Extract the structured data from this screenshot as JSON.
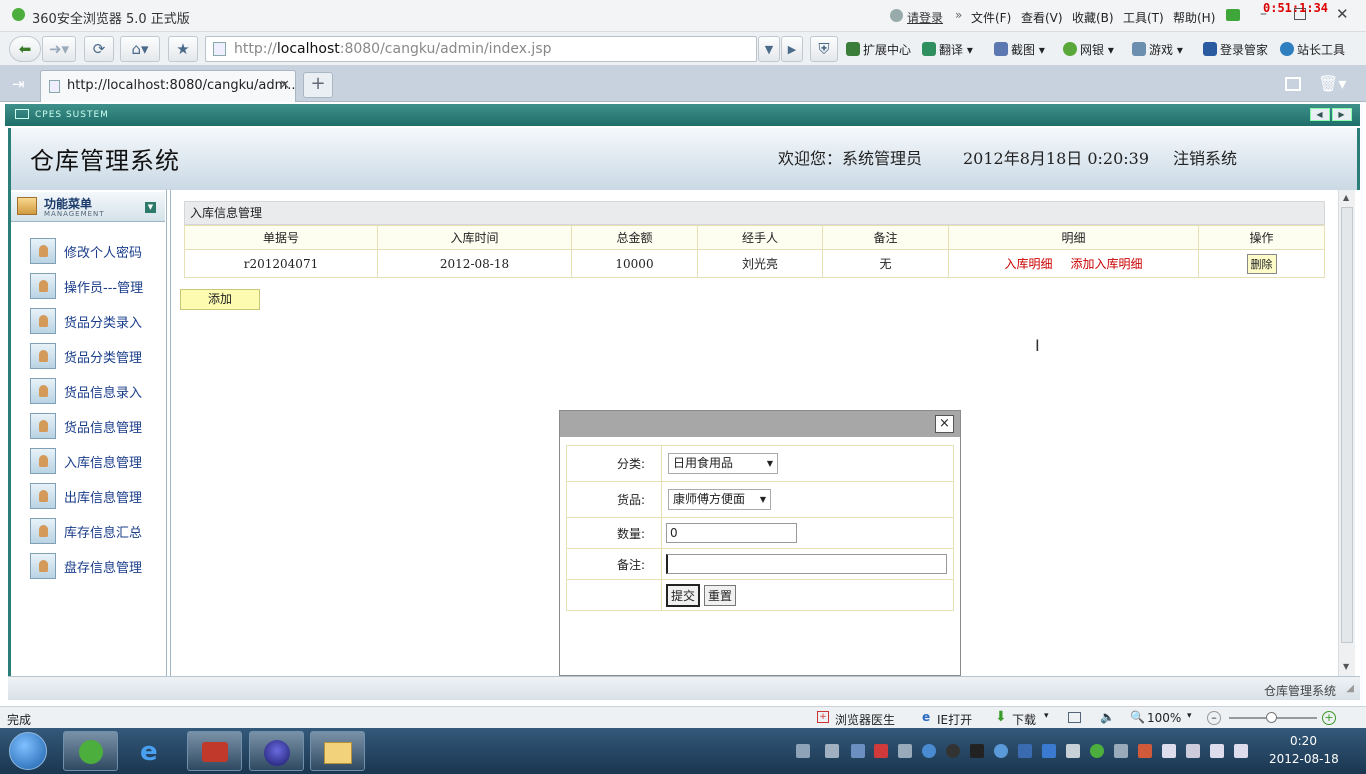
{
  "browser": {
    "title": "360安全浏览器 5.0 正式版",
    "login": "请登录",
    "menus": [
      "文件(F)",
      "查看(V)",
      "收藏(B)",
      "工具(T)",
      "帮助(H)"
    ],
    "timer": "0:51:1:34",
    "url_prefix": "http://",
    "url_host": "localhost",
    "url_rest": ":8080/cangku/admin/index.jsp",
    "tools": [
      "扩展中心",
      "翻译",
      "截图",
      "网银",
      "游戏",
      "登录管家",
      "站长工具"
    ],
    "tab_title": "http://localhost:8080/cangku/adm..."
  },
  "app": {
    "sys_label": "CPES SUSTEM",
    "title": "仓库管理系统",
    "welcome": "欢迎您：系统管理员",
    "datetime": "2012年8月18日  0:20:39",
    "logout": "注销系统",
    "menu_title": "功能菜单",
    "menu_sub": "MANAGEMENT",
    "menu_items": [
      "修改个人密码",
      "操作员---管理",
      "货品分类录入",
      "货品分类管理",
      "货品信息录入",
      "货品信息管理",
      "入库信息管理",
      "出库信息管理",
      "库存信息汇总",
      "盘存信息管理"
    ],
    "footer": "仓库管理系统"
  },
  "main": {
    "panel_title": "入库信息管理",
    "headers": [
      "单据号",
      "入库时间",
      "总金额",
      "经手人",
      "备注",
      "明细",
      "操作"
    ],
    "rows": [
      {
        "id": "r201204071",
        "date": "2012-08-18",
        "amount": "10000",
        "handler": "刘光亮",
        "note": "无",
        "detail1": "入库明细",
        "detail2": "添加入库明细",
        "op": "删除"
      }
    ],
    "add_label": "添加"
  },
  "dialog": {
    "close": "×",
    "category_label": "分类:",
    "category_value": "日用食用品",
    "goods_label": "货品:",
    "goods_value": "康师傅方便面",
    "qty_label": "数量:",
    "qty_value": "0",
    "note_label": "备注:",
    "note_value": "",
    "submit": "提交",
    "reset": "重置"
  },
  "statusbar": {
    "status": "完成",
    "doctor": "浏览器医生",
    "ie_open": "IE打开",
    "download": "下载",
    "zoom": "100%"
  },
  "taskbar": {
    "time": "0:20",
    "date": "2012-08-18"
  }
}
